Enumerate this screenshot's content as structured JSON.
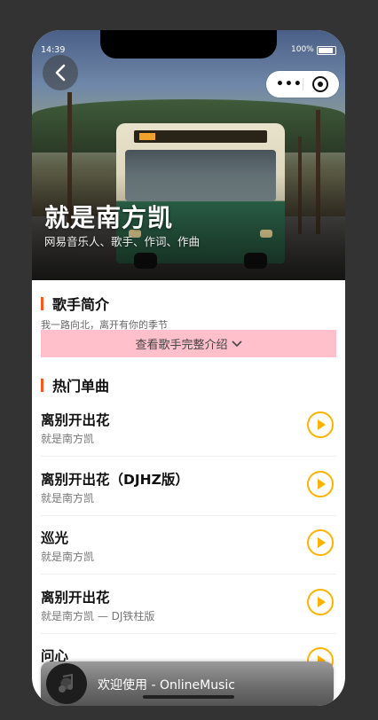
{
  "status": {
    "time": "14:39",
    "battery": "100%"
  },
  "artist": {
    "name": "就是南方凯",
    "subtitle": "网易音乐人、歌手、作词、作曲"
  },
  "intro": {
    "heading": "歌手简介",
    "text": "我一路向北，离开有你的季节",
    "more_button": "查看歌手完整介绍"
  },
  "hot": {
    "heading": "热门单曲",
    "songs": [
      {
        "title": "离别开出花",
        "artist": "就是南方凯"
      },
      {
        "title": "离别开出花（DJHZ版）",
        "artist": "就是南方凯"
      },
      {
        "title": "巡光",
        "artist": "就是南方凯"
      },
      {
        "title": "离别开出花",
        "artist": "就是南方凯 — DJ铁柱版"
      },
      {
        "title": "问心",
        "artist": ""
      }
    ]
  },
  "player": {
    "label": "欢迎使用 - OnlineMusic"
  },
  "colors": {
    "accent": "#ff5722",
    "play": "#ffb300",
    "intro_button_bg": "#ffc0cb"
  },
  "icons": {
    "back": "back-arrow-icon",
    "more": "more-dots-icon",
    "close": "target-icon",
    "play": "play-circle-icon",
    "chevron": "chevron-down-icon",
    "disc": "music-disc-icon"
  }
}
